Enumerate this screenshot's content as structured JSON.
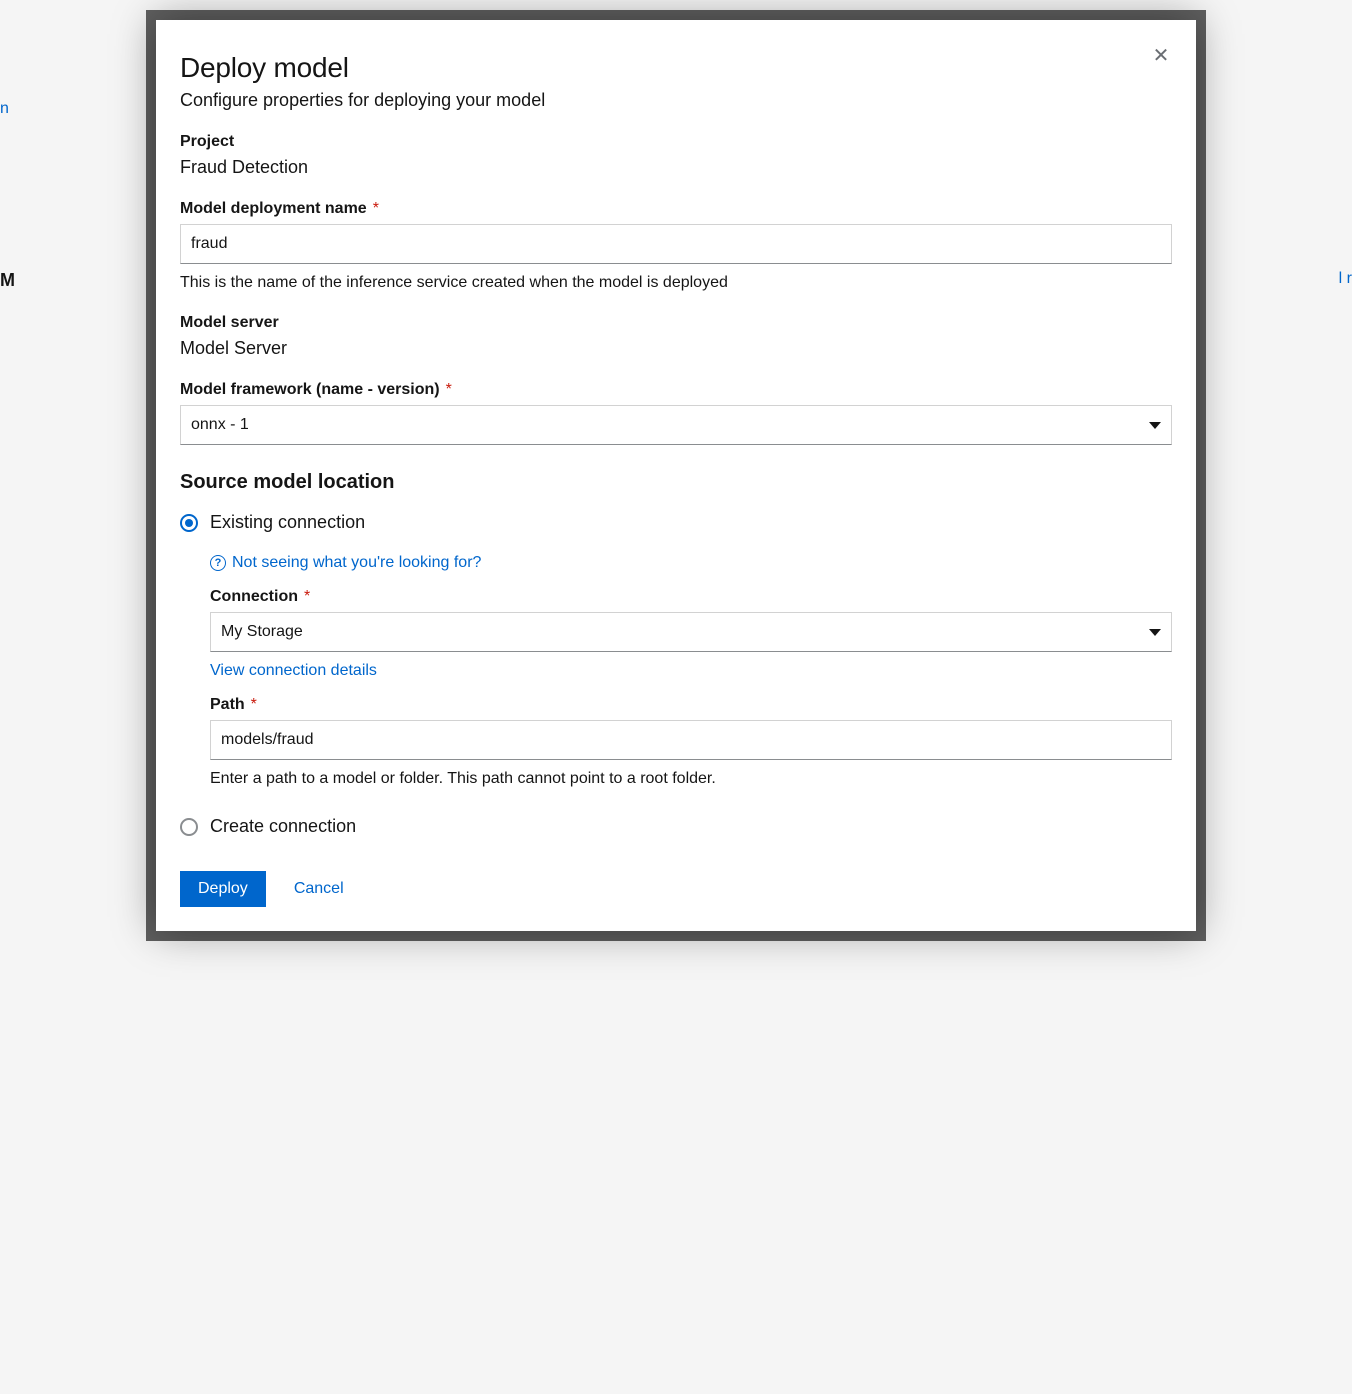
{
  "modal": {
    "title": "Deploy model",
    "description": "Configure properties for deploying your model",
    "close_aria": "Close"
  },
  "project": {
    "label": "Project",
    "value": "Fraud Detection"
  },
  "deployment_name": {
    "label": "Model deployment name",
    "value": "fraud",
    "help": "This is the name of the inference service created when the model is deployed"
  },
  "model_server": {
    "label": "Model server",
    "value": "Model Server"
  },
  "framework": {
    "label": "Model framework (name - version)",
    "selected": "onnx - 1"
  },
  "source_location": {
    "heading": "Source model location",
    "existing_label": "Existing connection",
    "create_label": "Create connection",
    "selected": "existing",
    "not_seeing": "Not seeing what you're looking for?",
    "connection": {
      "label": "Connection",
      "selected": "My Storage",
      "view_details": "View connection details"
    },
    "path": {
      "label": "Path",
      "value": "models/fraud",
      "help": "Enter a path to a model or folder. This path cannot point to a root folder."
    }
  },
  "footer": {
    "deploy": "Deploy",
    "cancel": "Cancel"
  }
}
